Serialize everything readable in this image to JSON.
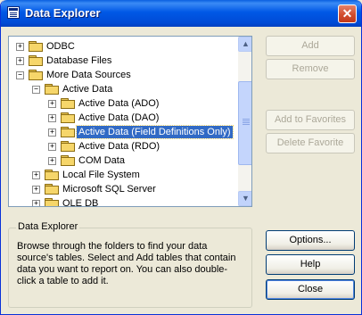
{
  "window": {
    "title": "Data Explorer",
    "close_glyph": "✕"
  },
  "tree": {
    "items": [
      {
        "label": "ODBC",
        "expander": "+",
        "level": 0,
        "selected": false
      },
      {
        "label": "Database Files",
        "expander": "+",
        "level": 0,
        "selected": false
      },
      {
        "label": "More Data Sources",
        "expander": "−",
        "level": 0,
        "selected": false
      },
      {
        "label": "Active Data",
        "expander": "−",
        "level": 1,
        "selected": false
      },
      {
        "label": "Active Data (ADO)",
        "expander": "+",
        "level": 2,
        "selected": false
      },
      {
        "label": "Active Data (DAO)",
        "expander": "+",
        "level": 2,
        "selected": false
      },
      {
        "label": "Active Data (Field Definitions Only)",
        "expander": "+",
        "level": 2,
        "selected": true
      },
      {
        "label": "Active Data (RDO)",
        "expander": "+",
        "level": 2,
        "selected": false
      },
      {
        "label": "COM Data",
        "expander": "+",
        "level": 2,
        "selected": false
      },
      {
        "label": "Local File System",
        "expander": "+",
        "level": 1,
        "selected": false
      },
      {
        "label": "Microsoft SQL Server",
        "expander": "+",
        "level": 1,
        "selected": false
      },
      {
        "label": "OLE DB",
        "expander": "+",
        "level": 1,
        "selected": false
      }
    ],
    "scroll_up_glyph": "▲",
    "scroll_down_glyph": "▼"
  },
  "buttons": {
    "add": "Add",
    "remove": "Remove",
    "add_to_favorites": "Add to Favorites",
    "delete_favorite": "Delete Favorite",
    "options": "Options...",
    "help": "Help",
    "close": "Close"
  },
  "description": {
    "title": "Data Explorer",
    "text": "Browse through the folders to find your data source's tables.  Select and Add tables that contain data you want to report on.  You can also double-click a table to add it."
  },
  "icons": [
    "app-icon",
    "close-icon",
    "folder-icon",
    "expand-icon",
    "collapse-icon",
    "scroll-up-icon",
    "scroll-down-icon"
  ],
  "colors": {
    "title_bar": "#0058e6",
    "selection": "#316ac5",
    "face": "#ece9d8",
    "folder": "#f6d66a"
  }
}
